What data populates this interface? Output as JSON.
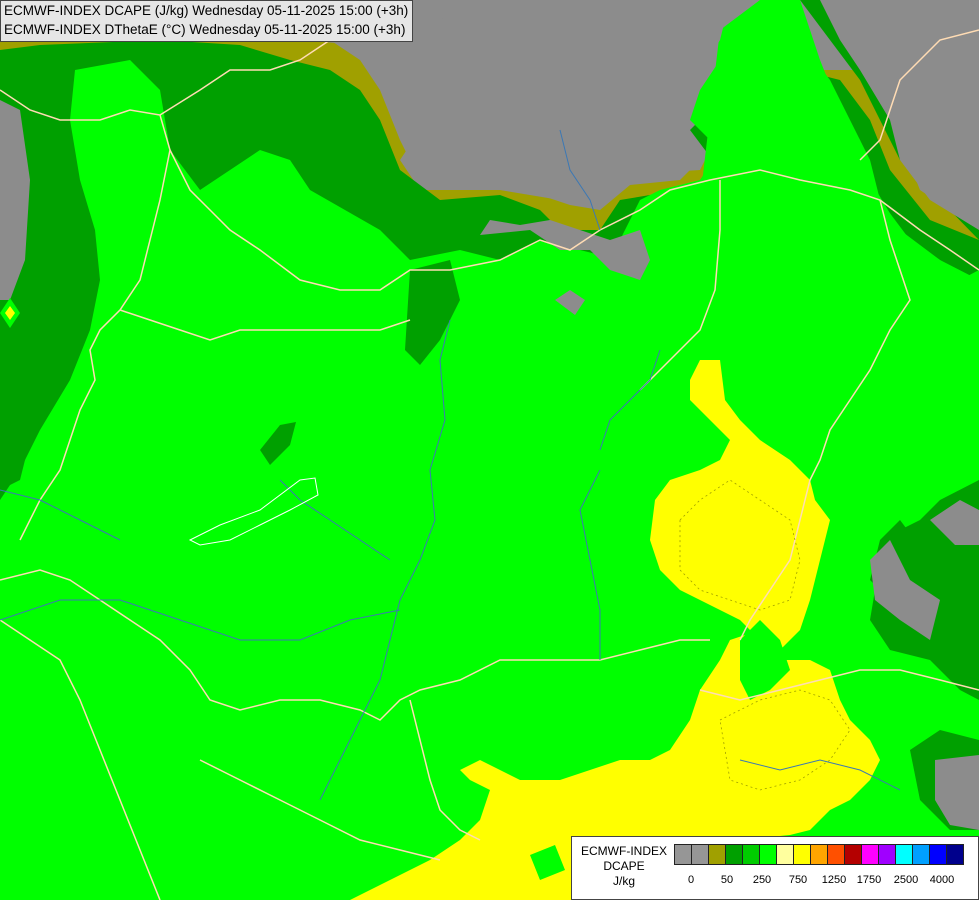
{
  "titles": {
    "line1": "ECMWF-INDEX DCAPE (J/kg) Wednesday 05-11-2025 15:00 (+3h)",
    "line2": "ECMWF-INDEX DThetaE (°C) Wednesday 05-11-2025 15:00 (+3h)"
  },
  "legend": {
    "line1": "ECMWF-INDEX",
    "line2": "DCAPE",
    "line3": "J/kg",
    "colors": [
      "#969696",
      "#969696",
      "#a0a000",
      "#00a000",
      "#00cc00",
      "#00ff00",
      "#ffff9e",
      "#ffff00",
      "#ffa500",
      "#ff5000",
      "#b40000",
      "#ff00ff",
      "#a000ff",
      "#00ffff",
      "#00a0ff",
      "#0000ff",
      "#00008c"
    ],
    "ticks": [
      "0",
      "50",
      "250",
      "750",
      "1250",
      "1750",
      "2500",
      "4000"
    ]
  },
  "map_colors": {
    "land_default": "#00ff00",
    "no_data": "#8c8c8c",
    "dark_green": "#00a000",
    "olive": "#a0a000",
    "yellow": "#ffff00",
    "pale_yellow": "#ffff9e",
    "borders": "#ffdcb4",
    "rivers": "#3c78b4"
  }
}
